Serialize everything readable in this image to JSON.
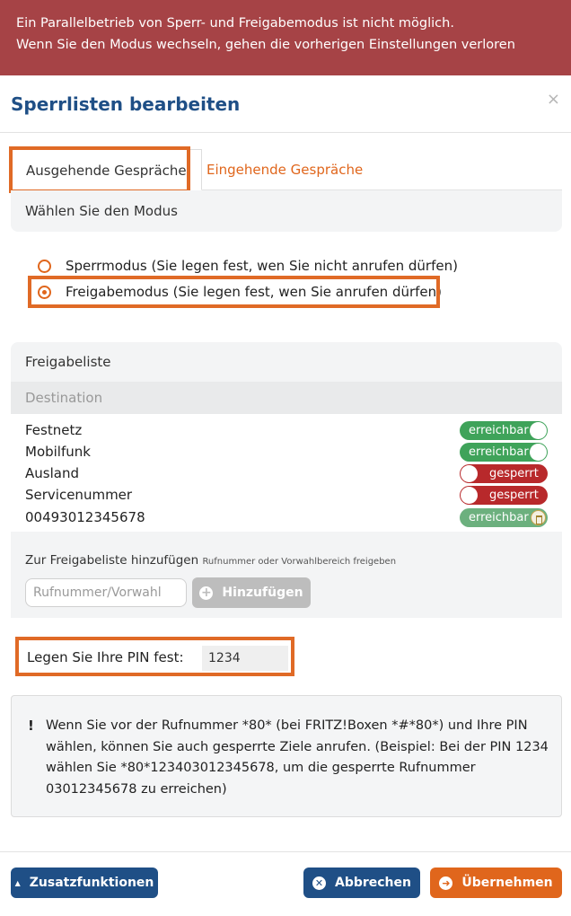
{
  "banner": {
    "line1": "Ein Parallelbetrieb von Sperr- und Freigabemodus ist nicht möglich.",
    "line2": "Wenn Sie den Modus wechseln, gehen die vorherigen Einstellungen verloren"
  },
  "modal": {
    "title": "Sperrlisten bearbeiten",
    "close": "×"
  },
  "tabs": [
    {
      "label": "Ausgehende Gespräche",
      "active": true
    },
    {
      "label": "Eingehende Gespräche",
      "active": false
    }
  ],
  "mode": {
    "heading": "Wählen Sie den Modus",
    "options": [
      {
        "label": "Sperrmodus (Sie legen fest, wen Sie nicht anrufen dürfen)",
        "checked": false
      },
      {
        "label": "Freigabemodus (Sie legen fest, wen Sie anrufen dürfen)",
        "checked": true
      }
    ]
  },
  "list": {
    "heading": "Freigabeliste",
    "column": "Destination",
    "rows": [
      {
        "name": "Festnetz",
        "status": "erreichbar"
      },
      {
        "name": "Mobilfunk",
        "status": "erreichbar"
      },
      {
        "name": "Ausland",
        "status": "gesperrt"
      },
      {
        "name": "Servicenummer",
        "status": "gesperrt"
      },
      {
        "name": "00493012345678",
        "status": "erreichbar"
      }
    ]
  },
  "add": {
    "title": "Zur Freigabeliste hinzufügen",
    "hint": "Rufnummer oder Vorwahlbereich freigeben",
    "placeholder": "Rufnummer/Vorwahl",
    "button": "Hinzufügen",
    "button_icon": "+"
  },
  "pin": {
    "label": "Legen Sie Ihre PIN fest:",
    "value": "1234"
  },
  "info": {
    "bang": "!",
    "text": "Wenn Sie vor der Rufnummer *80* (bei FRITZ!Boxen *#*80*) und Ihre PIN wählen, können Sie auch gesperrte Ziele anrufen. (Beispiel: Bei der PIN 1234 wählen Sie *80*123403012345678, um die gesperrte Rufnummer 03012345678 zu erreichen)"
  },
  "footer": {
    "extra": "Zusatzfunktionen",
    "extra_icon": "▲",
    "cancel": "Abbrechen",
    "cancel_icon": "✕",
    "apply": "Übernehmen",
    "apply_icon": "➜"
  },
  "colors": {
    "brand_blue": "#1f4f86",
    "accent_orange": "#e0661c",
    "banner_red": "#a64346",
    "on_green": "#3fa35a",
    "off_red": "#b8292b"
  }
}
